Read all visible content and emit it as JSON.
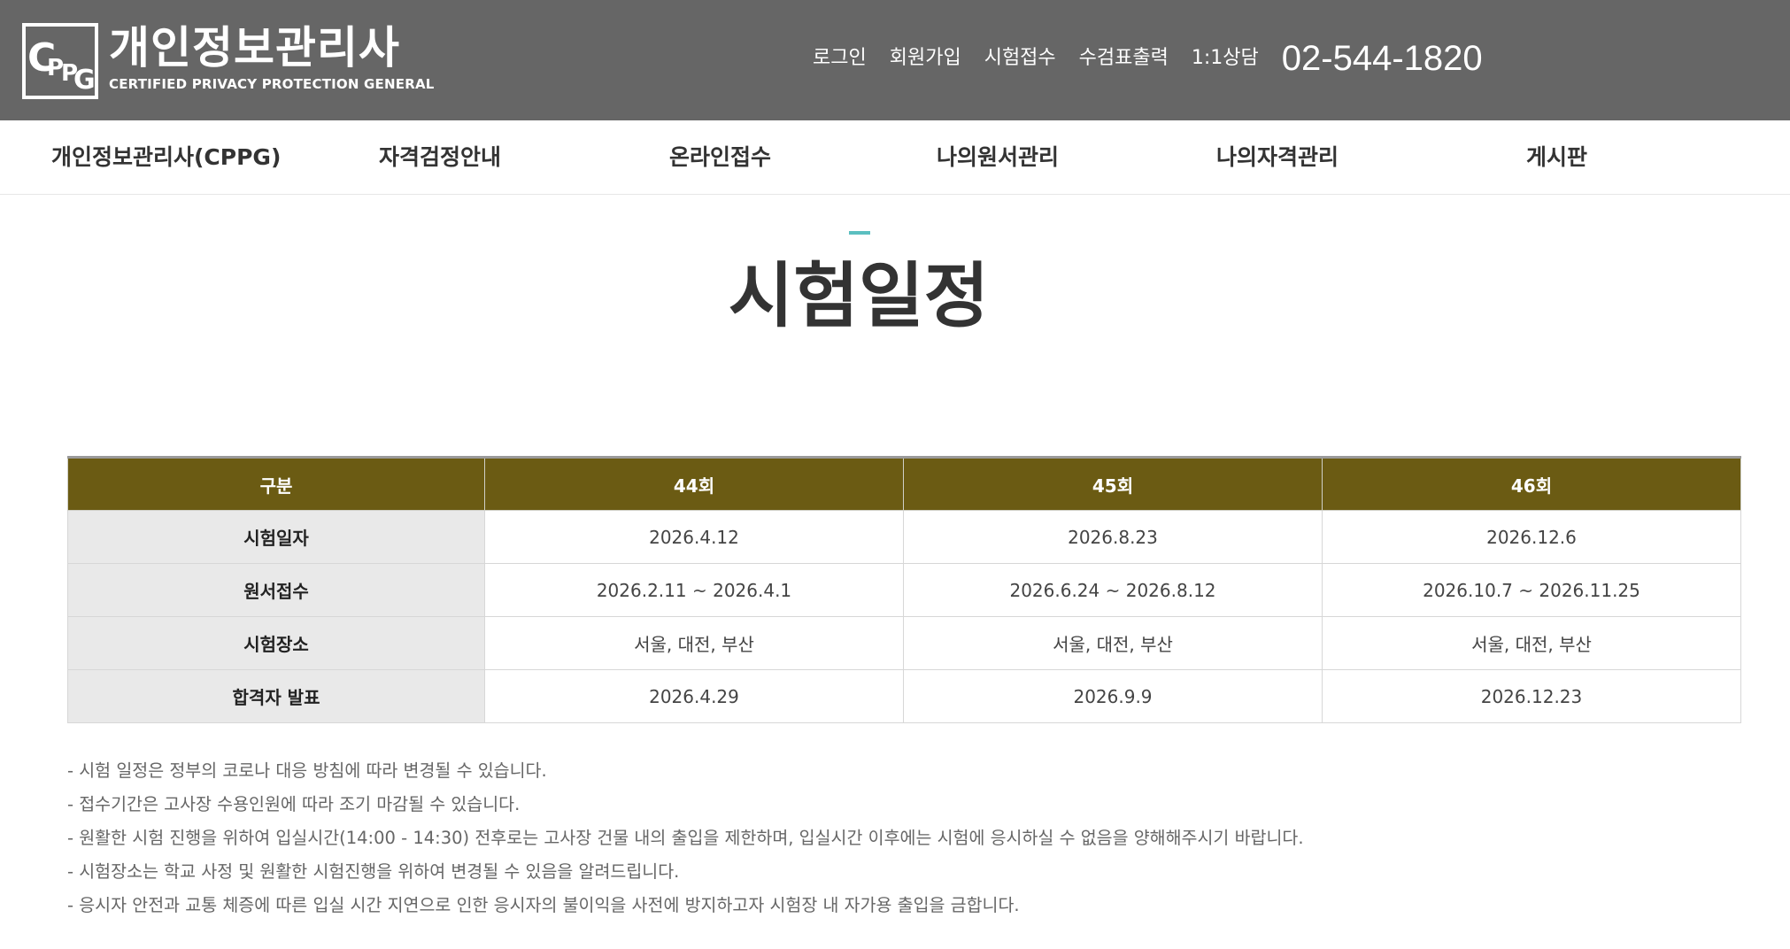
{
  "header": {
    "logo_title": "개인정보관리사",
    "logo_sub": "CERTIFIED PRIVACY PROTECTION GENERAL",
    "logo_mark": [
      "C",
      "P",
      "P",
      "G"
    ],
    "util_links": [
      "로그인",
      "회원가입",
      "시험접수",
      "수검표출력",
      "1:1상담"
    ],
    "phone": "02-544-1820"
  },
  "nav": {
    "items": [
      "개인정보관리사(CPPG)",
      "자격검정안내",
      "온라인접수",
      "나의원서관리",
      "나의자격관리",
      "게시판"
    ]
  },
  "page": {
    "title": "시험일정"
  },
  "schedule": {
    "headers": [
      "구분",
      "44회",
      "45회",
      "46회"
    ],
    "rows": [
      {
        "label": "시험일자",
        "cells": [
          "2026.4.12",
          "2026.8.23",
          "2026.12.6"
        ]
      },
      {
        "label": "원서접수",
        "cells": [
          "2026.2.11 ~ 2026.4.1",
          "2026.6.24 ~ 2026.8.12",
          "2026.10.7 ~ 2026.11.25"
        ]
      },
      {
        "label": "시험장소",
        "cells": [
          "서울, 대전, 부산",
          "서울, 대전, 부산",
          "서울, 대전, 부산"
        ]
      },
      {
        "label": "합격자 발표",
        "cells": [
          "2026.4.29",
          "2026.9.9",
          "2026.12.23"
        ]
      }
    ]
  },
  "notes": [
    "- 시험 일정은 정부의 코로나 대응 방침에 따라 변경될 수 있습니다.",
    "- 접수기간은 고사장 수용인원에 따라 조기 마감될 수 있습니다.",
    "- 원활한 시험 진행을 위하여 입실시간(14:00 - 14:30) 전후로는 고사장 건물 내의 출입을 제한하며, 입실시간 이후에는 시험에 응시하실 수 없음을 양해해주시기 바랍니다.",
    "- 시험장소는 학교 사정 및 원활한 시험진행을 위하여 변경될 수 있음을 알려드립니다.",
    "- 응시자 안전과 교통 체증에 따른 입실 시간 지연으로 인한 응시자의 불이익을 사전에 방지하고자 시험장 내 자가용 출입을 금합니다."
  ],
  "colors": {
    "header_bg": "#666666",
    "table_head_bg": "#6b5b13",
    "row_label_bg": "#e9e9e9",
    "title_accent": "#5bbfc0"
  }
}
